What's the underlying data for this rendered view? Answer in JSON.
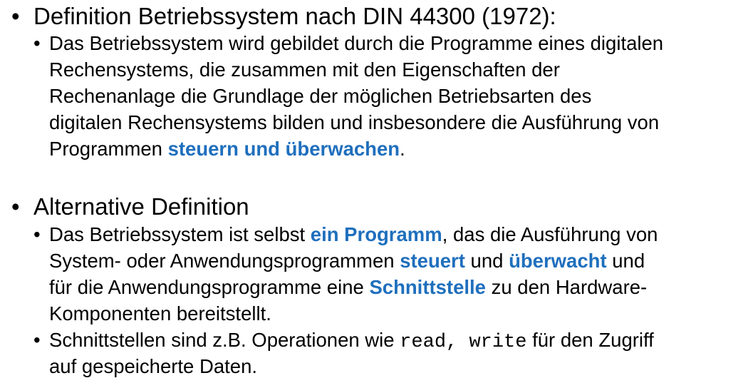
{
  "section1": {
    "heading": "Definition Betriebssystem nach DIN 44300 (1972):",
    "sub": {
      "l1": "Das Betriebssystem wird gebildet durch die Programme eines digitalen",
      "l2": "Rechensystems, die zusammen mit den Eigenschaften der",
      "l3": "Rechenanlage die Grundlage der möglichen Betriebsarten des",
      "l4": "digitalen Rechensystems bilden und insbesondere die Ausführung von",
      "l5_a": "Programmen ",
      "l5_hl": "steuern und überwachen",
      "l5_b": "."
    }
  },
  "section2": {
    "heading": "Alternative Definition",
    "sub1": {
      "l1_a": "Das Betriebssystem ist selbst ",
      "l1_hl": "ein Programm",
      "l1_b": ", das die Ausführung von",
      "l2_a": "System- oder Anwendungsprogrammen ",
      "l2_hl1": "steuert",
      "l2_b": " und ",
      "l2_hl2": "überwacht",
      "l2_c": " und",
      "l3_a": "für die Anwendungsprogramme eine ",
      "l3_hl": "Schnittstelle",
      "l3_b": " zu den Hardware-",
      "l4": "Komponenten bereitstellt."
    },
    "sub2": {
      "l1_a": "Schnittstellen sind z.B. Operationen wie ",
      "l1_code1": "read,",
      "l1_gap": " ",
      "l1_code2": "write",
      "l1_b": " für den Zugriff",
      "l2": "auf gespeicherte Daten."
    }
  },
  "bullet_char": "•",
  "colors": {
    "highlight": "#1f6fbd",
    "text": "#000000",
    "background": "#ffffff"
  }
}
